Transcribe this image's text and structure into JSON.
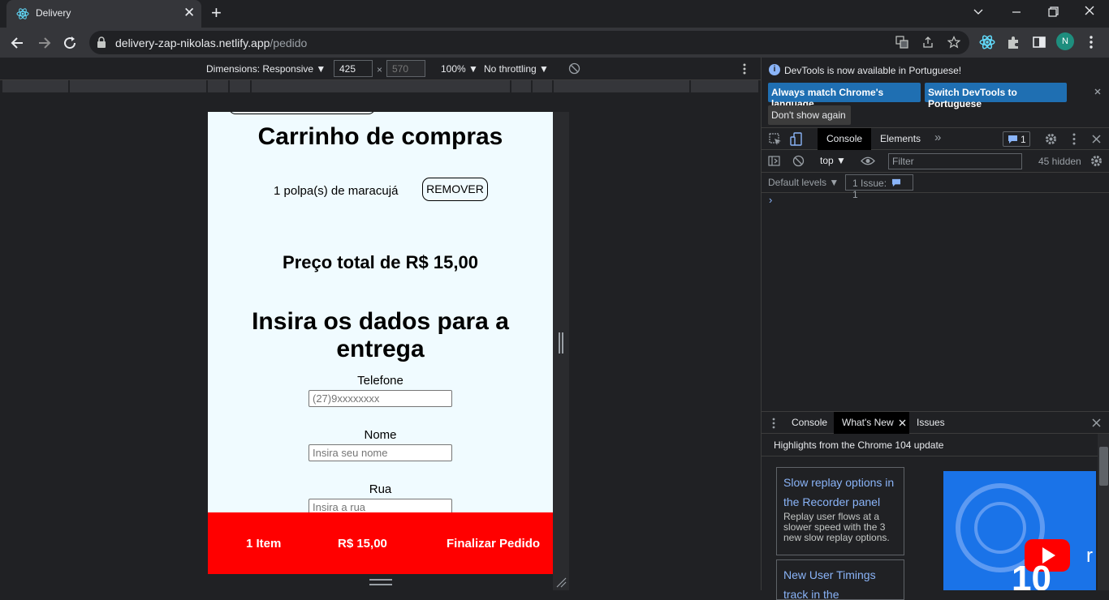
{
  "browser": {
    "tab_title": "Delivery",
    "tab_close": "✕",
    "new_tab": "+",
    "url_host": "delivery-zap-nikolas.netlify.app",
    "url_path": "/pedido",
    "avatar_letter": "N",
    "window_controls": [
      "chevron-down-icon",
      "minimize-icon",
      "restore-icon",
      "close-icon"
    ]
  },
  "device_toolbar": {
    "dimensions_label": "Dimensions: Responsive ▼",
    "width": "425",
    "height": "570",
    "times": "×",
    "zoom": "100% ▼",
    "throttling": "No throttling ▼"
  },
  "page": {
    "cart_title": "Carrinho de compras",
    "item_text": "1 polpa(s) de maracujá",
    "remove_label": "REMOVER",
    "total_text": "Preço total de R$ 15,00",
    "data_title": "Insira os dados para a entrega",
    "phone_label": "Telefone",
    "phone_placeholder": "(27)9xxxxxxxx",
    "name_label": "Nome",
    "name_placeholder": "Insira seu nome",
    "street_label": "Rua",
    "street_placeholder": "Insira a rua",
    "footer_items": "1 Item",
    "footer_price": "R$ 15,00",
    "footer_finish": "Finalizar Pedido",
    "accent_color": "#ff0000"
  },
  "devtools": {
    "info_message": "DevTools is now available in Portuguese!",
    "btn_match": "Always match Chrome's language",
    "btn_switch": "Switch DevTools to Portuguese",
    "btn_dont_show": "Don't show again",
    "tab_console": "Console",
    "tab_elements": "Elements",
    "more_tabs": "»",
    "issues_count": "1",
    "context": "top ▼",
    "filter_placeholder": "Filter",
    "hidden_count": "45 hidden",
    "default_levels": "Default levels ▼",
    "issue_label": "1 Issue:",
    "issue_count": "1",
    "prompt": "›",
    "drawer_console": "Console",
    "drawer_whatsnew": "What's New",
    "drawer_issues": "Issues",
    "highlights": "Highlights from the Chrome 104 update",
    "card1_title": "Slow replay options in the Recorder panel",
    "card1_desc": "Replay user flows at a slower speed with the 3 new slow replay options.",
    "card2_title": "New User Timings track in the"
  }
}
